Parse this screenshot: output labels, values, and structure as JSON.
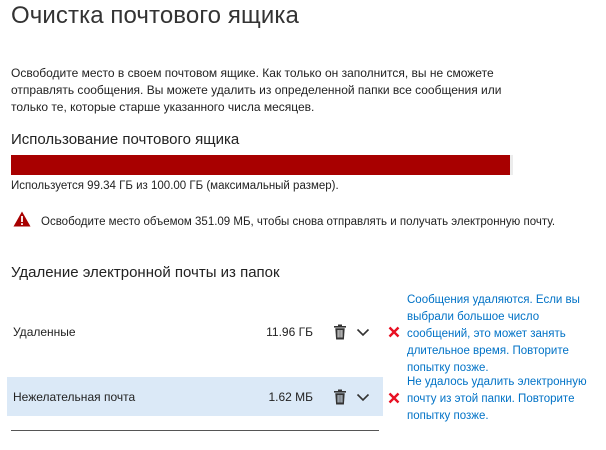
{
  "page": {
    "title": "Очистка почтового ящика",
    "intro": "Освободите место в своем почтовом ящике. Как только он заполнится, вы не сможете отправлять сообщения. Вы можете удалить из определенной папки все сообщения или только те, которые старше указанного числа месяцев."
  },
  "usage": {
    "heading": "Использование почтового ящика",
    "text": "Используется 99.34 ГБ из 100.00 ГБ (максимальный размер).",
    "fraction_used": 0.9934,
    "bar_color": "#a80000"
  },
  "warning": {
    "icon": "warning-triangle-icon",
    "text": "Освободите место объемом 351.09 МБ, чтобы снова отправлять и получать электронную почту."
  },
  "folders": {
    "section_title": "Удаление электронной почты из папок",
    "items": [
      {
        "name": "Удаленные",
        "size": "11.96 ГБ",
        "selected": false,
        "error": "Сообщения удаляются. Если вы выбрали большое число сообщений, это может занять длительное время. Повторите попытку позже."
      },
      {
        "name": "Нежелательная почта",
        "size": "1.62 МБ",
        "selected": true,
        "error": "Не удалось удалить электронную почту из этой папки. Повторите попытку позже."
      }
    ]
  },
  "colors": {
    "link": "#0072c6",
    "error_x": "#e81123",
    "selected_row": "#dbe9f7"
  }
}
